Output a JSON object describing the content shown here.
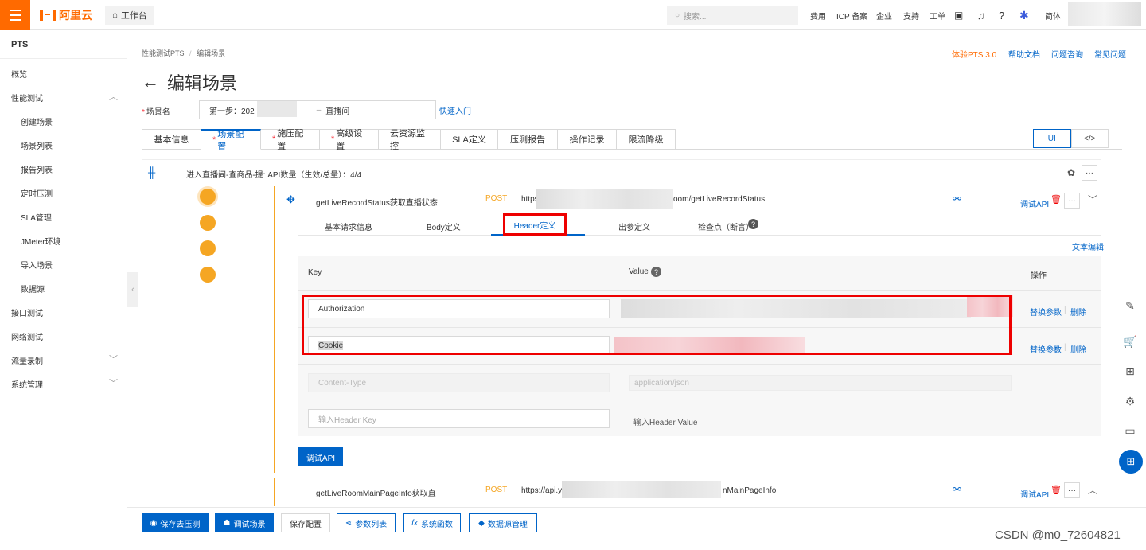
{
  "brand": {
    "logo_text": "阿里云",
    "workbench": "工作台"
  },
  "search": {
    "placeholder": "搜索..."
  },
  "topnav": [
    "费用",
    "ICP 备案",
    "企业",
    "支持",
    "工单",
    "简体"
  ],
  "sidebar": {
    "title": "PTS",
    "items": [
      {
        "label": "概览"
      },
      {
        "label": "性能测试",
        "expanded": true,
        "children": [
          "创建场景",
          "场景列表",
          "报告列表",
          "定时压测",
          "SLA管理",
          "JMeter环境",
          "导入场景",
          "数据源"
        ]
      },
      {
        "label": "接口测试"
      },
      {
        "label": "网络测试"
      },
      {
        "label": "流量录制"
      },
      {
        "label": "系统管理"
      }
    ]
  },
  "breadcrumb": {
    "root": "性能测试PTS",
    "sep": "/",
    "current": "编辑场景"
  },
  "header_links": {
    "try": "体验PTS 3.0",
    "docs": "帮助文档",
    "consult": "问题咨询",
    "faq": "常见问题"
  },
  "page": {
    "title": "编辑场景",
    "back_icon": "←"
  },
  "scene": {
    "label": "场景名",
    "value_prefix": "第一步：202",
    "value_suffix": "直播间",
    "quick_link": "快速入门"
  },
  "tabs": [
    {
      "label": "基本信息",
      "required": false
    },
    {
      "label": "场景配置",
      "required": true,
      "active": true
    },
    {
      "label": "施压配置",
      "required": true
    },
    {
      "label": "高级设置",
      "required": true
    },
    {
      "label": "云资源监控",
      "required": false
    },
    {
      "label": "SLA定义",
      "required": false
    },
    {
      "label": "压测报告",
      "required": false
    },
    {
      "label": "操作记录",
      "required": false
    },
    {
      "label": "限流降级",
      "required": false
    }
  ],
  "view_toggle": {
    "ui": "UI",
    "code": "</>"
  },
  "api_group": {
    "title": "进入直播间-查商品-提: API数量（生效/总量）：4/4"
  },
  "request1": {
    "name": "getLiveRecordStatus获取直播状态",
    "method": "POST",
    "url_prefix": "https:",
    "url_suffix": "oom/getLiveRecordStatus",
    "debug": "调试API",
    "more": "···"
  },
  "subtabs": [
    "基本请求信息",
    "Body定义",
    "Header定义",
    "出参定义",
    "检查点（断言）"
  ],
  "text_edit": "文本编辑",
  "header_table": {
    "col_key": "Key",
    "col_value": "Value",
    "col_op": "操作",
    "rows": [
      {
        "key": "Authorization",
        "op1": "替换参数",
        "op2": "删除"
      },
      {
        "key": "Cookie",
        "op1": "替换参数",
        "op2": "删除"
      },
      {
        "key": "Content-Type",
        "value": "application/json"
      }
    ],
    "new_key_placeholder": "输入Header Key",
    "new_value_placeholder": "输入Header Value"
  },
  "debug_button": "调试API",
  "request2": {
    "name": "getLiveRoomMainPageInfo获取直",
    "method": "POST",
    "url_prefix": "https://api.yi",
    "url_suffix": "nMainPageInfo",
    "debug": "调试API",
    "more": "···"
  },
  "bottom": {
    "save_run": "保存去压测",
    "debug_scene": "调试场景",
    "save_config": "保存配置",
    "params": "参数列表",
    "functions": "系统函数",
    "datasource": "数据源管理"
  },
  "watermark": "CSDN @m0_72604821",
  "colors": {
    "accent": "#0064c8",
    "brand": "#ff6a00",
    "highlight": "#e00000",
    "step": "#f5a623"
  }
}
